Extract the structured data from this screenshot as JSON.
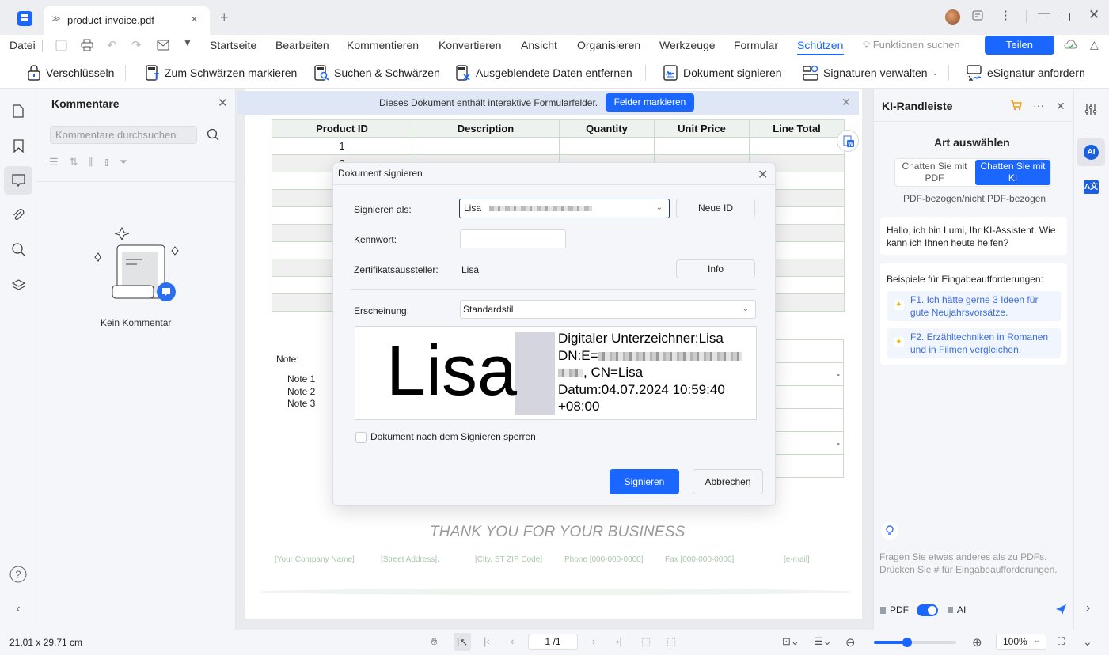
{
  "titlebar": {
    "tab_title": "product-invoice.pdf",
    "new_tab": "+",
    "window_controls": [
      "minimize",
      "maximize",
      "close"
    ]
  },
  "menu": {
    "file": "Datei",
    "items": [
      "Startseite",
      "Bearbeiten",
      "Kommentieren",
      "Konvertieren",
      "Ansicht",
      "Organisieren",
      "Werkzeuge",
      "Formular",
      "Schützen"
    ],
    "active": "Schützen",
    "search_features": "Funktionen suchen",
    "share": "Teilen"
  },
  "toolbar": {
    "items": [
      {
        "label": "Verschlüsseln",
        "icon": "lock-icon"
      },
      {
        "label": "Zum Schwärzen markieren",
        "icon": "mark-redaction-icon"
      },
      {
        "label": "Suchen & Schwärzen",
        "icon": "search-redact-icon"
      },
      {
        "label": "Ausgeblendete Daten entfernen",
        "icon": "remove-hidden-data-icon"
      },
      {
        "label": "Dokument signieren",
        "icon": "sign-document-icon"
      },
      {
        "label": "Signaturen verwalten",
        "icon": "manage-signatures-icon"
      },
      {
        "label": "eSignatur anfordern",
        "icon": "request-esignature-icon"
      }
    ]
  },
  "comments_panel": {
    "title": "Kommentare",
    "search_placeholder": "Kommentare durchsuchen",
    "empty_text": "Kein Kommentar"
  },
  "form_banner": {
    "text": "Dieses Dokument enthält interaktive Formularfelder.",
    "button": "Felder markieren"
  },
  "invoice": {
    "columns": [
      "Product ID",
      "Description",
      "Quantity",
      "Unit Price",
      "Line Total"
    ],
    "rows": [
      [
        "1",
        "",
        "",
        "",
        ""
      ],
      [
        "2",
        "",
        "",
        "",
        ""
      ],
      [
        "",
        "",
        "",
        "",
        ""
      ],
      [
        "",
        "",
        "",
        "",
        ""
      ],
      [
        "",
        "",
        "",
        "",
        ""
      ],
      [
        "",
        "",
        "",
        "",
        ""
      ],
      [
        "",
        "",
        "",
        "",
        ""
      ],
      [
        "",
        "",
        "",
        "",
        ""
      ],
      [
        "",
        "",
        "",
        "",
        ""
      ],
      [
        "",
        "",
        "",
        "",
        ""
      ]
    ],
    "note_label": "Note:",
    "notes": [
      "Note 1",
      "Note 2",
      "Note 3"
    ],
    "totals": [
      "",
      "-",
      "",
      "",
      "-",
      ""
    ],
    "thanks": "THANK YOU FOR YOUR BUSINESS",
    "footer": [
      "[Your Company Name]",
      "[Street Address],",
      "[City, ST ZIP Code]",
      "Phone [000-000-0000]",
      "Fax [000-000-0000]",
      "[e-mail]"
    ]
  },
  "dialog": {
    "title": "Dokument signieren",
    "sign_as_label": "Signieren als:",
    "sign_as_value": "Lisa",
    "new_id_button": "Neue ID",
    "password_label": "Kennwort:",
    "password_value": "",
    "issuer_label": "Zertifikatsaussteller:",
    "issuer_value": "Lisa",
    "info_button": "Info",
    "appearance_label": "Erscheinung:",
    "appearance_value": "Standardstil",
    "preview": {
      "name": "Lisa",
      "line1": "Digitaler Unterzeichner:Lisa",
      "line2_prefix": "DN:E=",
      "line3_suffix": ", CN=Lisa",
      "line4": "Datum:04.07.2024 10:59:40",
      "line5": "+08:00"
    },
    "lock_checkbox_label": "Dokument nach dem Signieren sperren",
    "lock_checked": false,
    "sign_button": "Signieren",
    "cancel_button": "Abbrechen"
  },
  "ai_panel": {
    "title": "KI-Randleiste",
    "mode_title": "Art auswählen",
    "mode_pdf": "Chatten Sie mit PDF",
    "mode_ki": "Chatten Sie mit KI",
    "mode_active": "Chatten Sie mit KI",
    "mode_subtitle": "PDF-bezogen/nicht PDF-bezogen",
    "greeting": "Hallo, ich bin Lumi, Ihr KI-Assistent. Wie kann ich Ihnen heute helfen?",
    "examples_title": "Beispiele für Eingabeaufforderungen:",
    "examples": [
      "F1. Ich hätte gerne 3 Ideen für gute Neujahrsvorsätze.",
      "F2. Erzähltechniken in Romanen und in Filmen vergleichen."
    ],
    "input_placeholder": "Fragen Sie etwas anderes als zu PDFs. Drücken Sie # für Eingabeaufforderungen.",
    "toggle_left": "PDF",
    "toggle_right": "AI",
    "toggle_on": true
  },
  "statusbar": {
    "dimensions": "21,01 x 29,71 cm",
    "page": "1 /1",
    "zoom": "100%",
    "zoom_fraction": 0.4
  },
  "colors": {
    "accent": "#1a66ff",
    "table_border": "#c8dcc8"
  }
}
